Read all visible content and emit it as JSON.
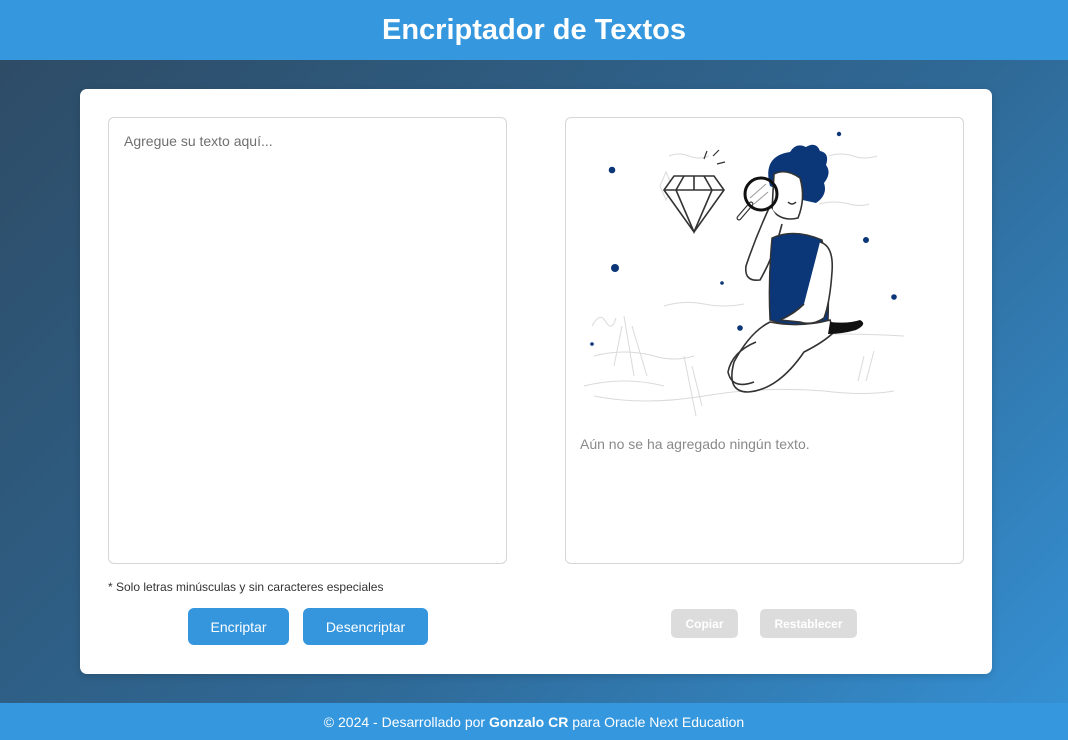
{
  "header": {
    "title": "Encriptador de Textos"
  },
  "input": {
    "placeholder": "Agregue su texto aquí...",
    "value": ""
  },
  "note": "* Solo letras minúsculas y sin caracteres especiales",
  "buttons": {
    "encrypt": "Encriptar",
    "decrypt": "Desencriptar",
    "copy": "Copiar",
    "reset": "Restablecer"
  },
  "output": {
    "empty_message": "Aún no se ha agregado ningún texto.",
    "illustration": "person-with-magnifying-glass-diamond"
  },
  "footer": {
    "prefix": "© 2024 - Desarrollado por ",
    "author": "Gonzalo CR",
    "suffix": " para Oracle Next Education"
  },
  "colors": {
    "accent": "#3597de",
    "illustration_navy": "#0b3677",
    "disabled": "#dcdcdc"
  }
}
